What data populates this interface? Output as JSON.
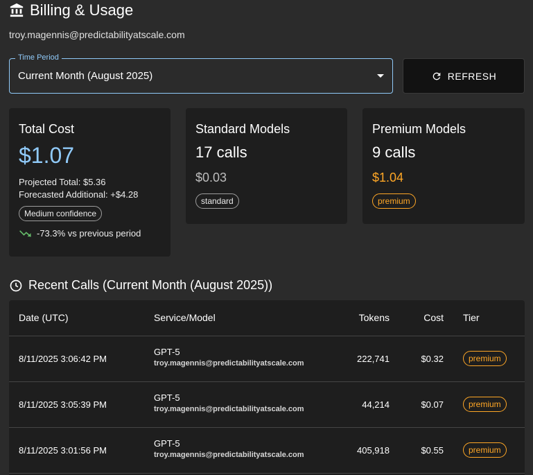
{
  "header": {
    "title": "Billing & Usage",
    "icon": "bank-icon",
    "email": "troy.magennis@predictabilityatscale.com"
  },
  "time_period": {
    "label": "Time Period",
    "value": "Current Month (August 2025)"
  },
  "refresh": {
    "label": "REFRESH",
    "icon": "refresh-icon"
  },
  "cards": {
    "total": {
      "title": "Total Cost",
      "value": "$1.07",
      "projected": "Projected Total: $5.36",
      "forecasted": "Forecasted Additional: +$4.28",
      "confidence": "Medium confidence",
      "trend": "-73.3% vs previous period"
    },
    "standard": {
      "title": "Standard Models",
      "calls": "17 calls",
      "cost": "$0.03",
      "tier": "standard"
    },
    "premium": {
      "title": "Premium Models",
      "calls": "9 calls",
      "cost": "$1.04",
      "tier": "premium"
    }
  },
  "recent": {
    "title": "Recent Calls (Current Month (August 2025))",
    "columns": {
      "date": "Date (UTC)",
      "service": "Service/Model",
      "tokens": "Tokens",
      "cost": "Cost",
      "tier": "Tier"
    },
    "rows": [
      {
        "date": "8/11/2025 3:06:42 PM",
        "model": "GPT-5",
        "email": "troy.magennis@predictabilityatscale.com",
        "tokens": "222,741",
        "cost": "$0.32",
        "tier": "premium"
      },
      {
        "date": "8/11/2025 3:05:39 PM",
        "model": "GPT-5",
        "email": "troy.magennis@predictabilityatscale.com",
        "tokens": "44,214",
        "cost": "$0.07",
        "tier": "premium"
      },
      {
        "date": "8/11/2025 3:01:56 PM",
        "model": "GPT-5",
        "email": "troy.magennis@predictabilityatscale.com",
        "tokens": "405,918",
        "cost": "$0.55",
        "tier": "premium"
      }
    ]
  },
  "colors": {
    "accent": "#90caf9",
    "premium": "#ffa726",
    "trend_down": "#66bb6a",
    "background": "#2b2b2b",
    "card": "#1e1e1e"
  }
}
